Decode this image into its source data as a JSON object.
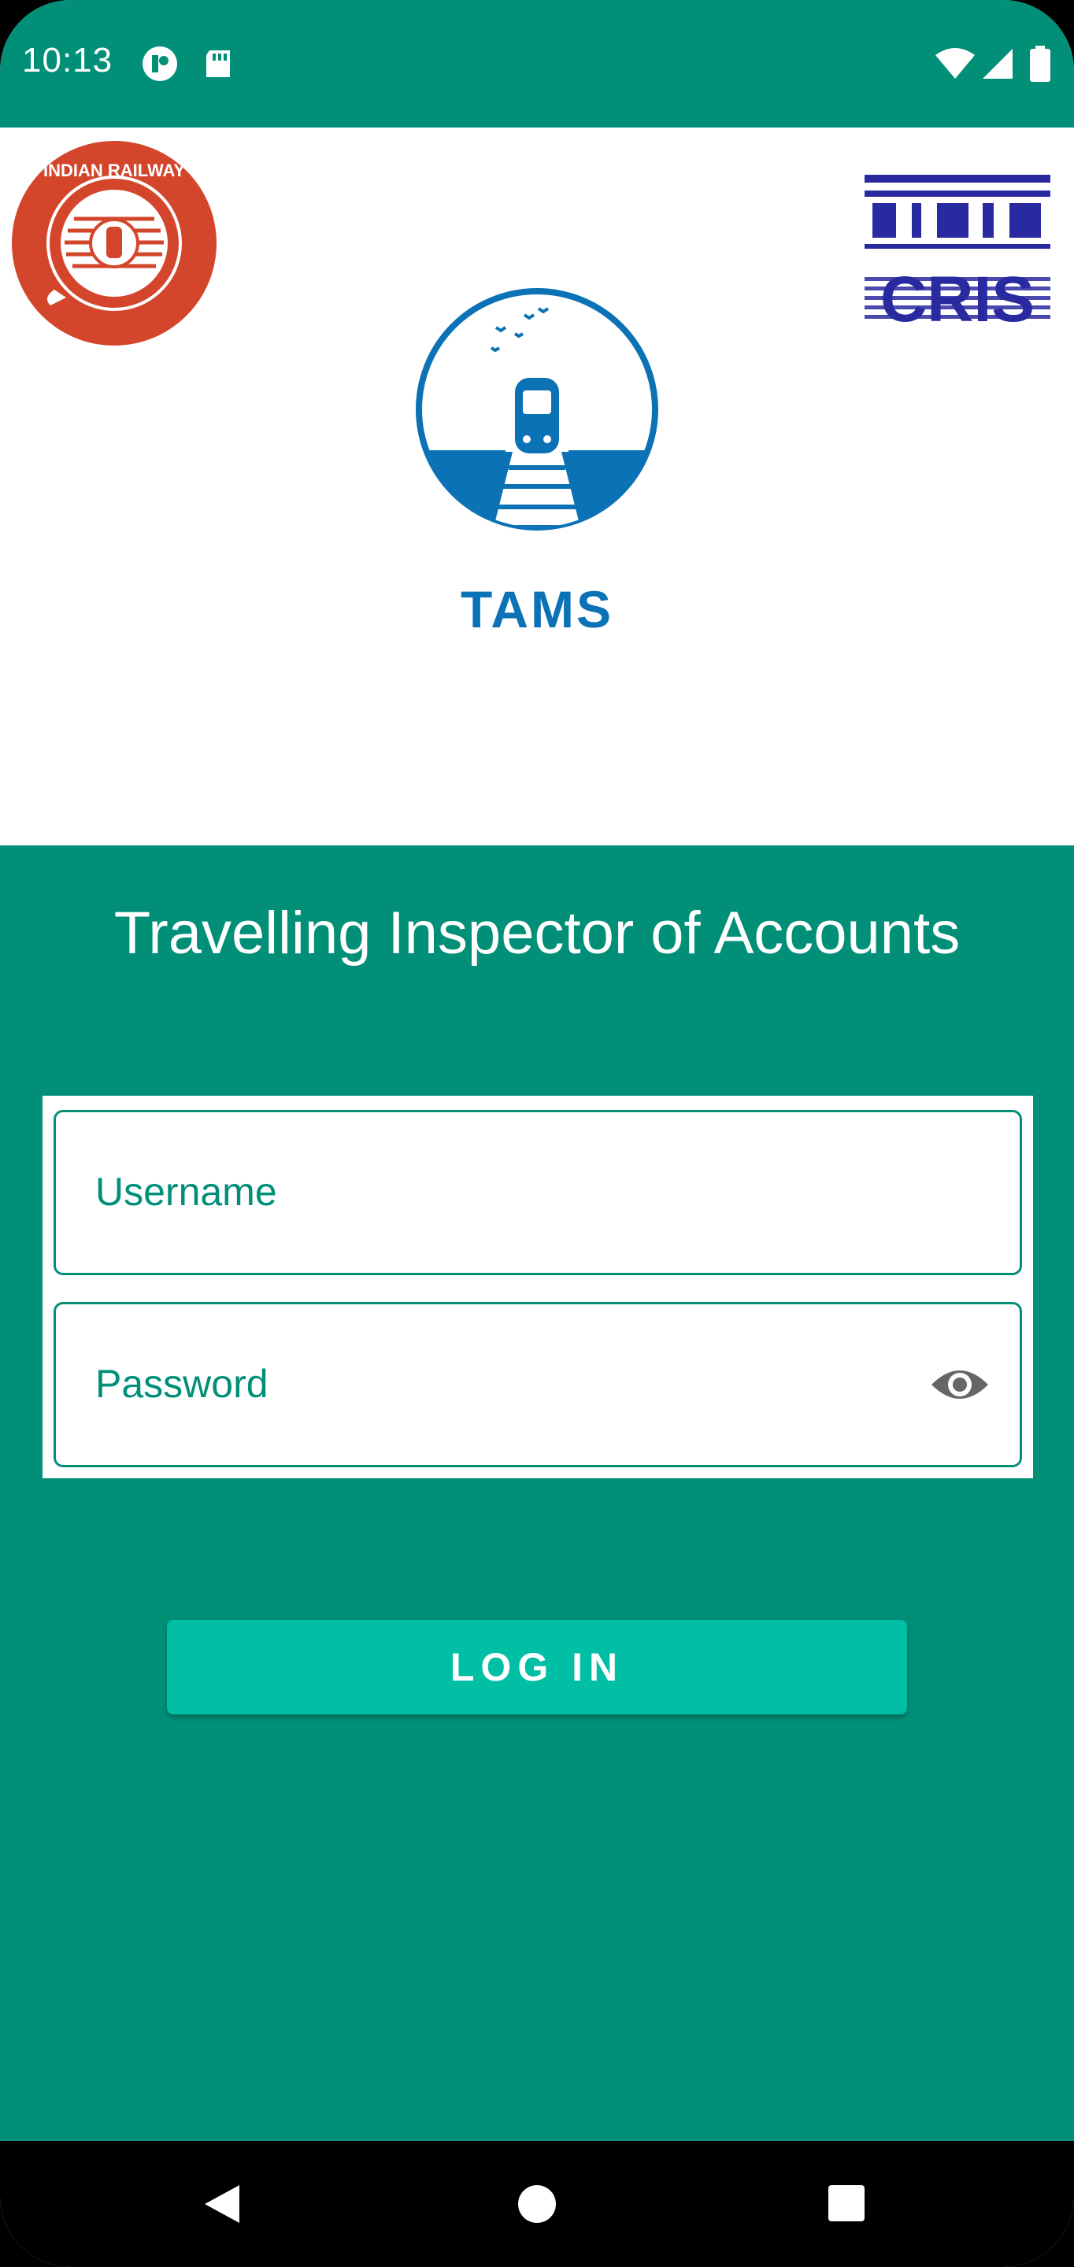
{
  "status_bar": {
    "time": "10:13",
    "icons_left": [
      "t-badge-icon",
      "sd-card-icon"
    ],
    "icons_right": [
      "wifi-icon",
      "signal-icon",
      "battery-icon"
    ]
  },
  "header": {
    "left_logo": "indian-railway-logo",
    "left_logo_text": "INDIAN RAILWAY",
    "right_logo": "cris-logo",
    "right_logo_text": "CRIS",
    "app_logo": "tams-train-logo",
    "app_name": "TAMS"
  },
  "main": {
    "subtitle": "Travelling Inspector of Accounts",
    "username": {
      "label": "Username",
      "value": ""
    },
    "password": {
      "label": "Password",
      "value": ""
    },
    "login_label": "LOG IN"
  },
  "nav": {
    "back": "back-icon",
    "home": "home-icon",
    "recents": "recents-icon"
  },
  "colors": {
    "primary": "#018f78",
    "accent": "#00bfa5",
    "brand_blue": "#0a72b5",
    "railway_red": "#d4462c",
    "cris_blue": "#2a2aa0"
  }
}
